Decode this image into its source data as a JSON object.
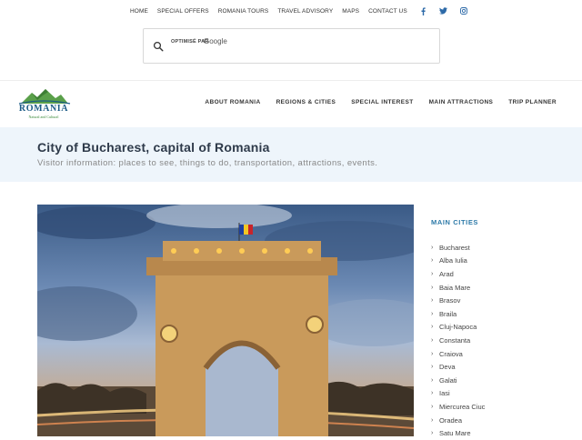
{
  "topnav": {
    "items": [
      "HOME",
      "SPECIAL OFFERS",
      "ROMANIA TOURS",
      "TRAVEL ADVISORY",
      "MAPS",
      "CONTACT US"
    ],
    "social_icons": [
      "facebook-icon",
      "twitter-icon",
      "instagram-icon"
    ]
  },
  "search": {
    "powered_label": "OPTIMISÉ PAR",
    "provider": "Google",
    "value": ""
  },
  "logo": {
    "name": "ROMANIA",
    "tagline": "Natural and Cultural"
  },
  "mainnav": {
    "items": [
      "ABOUT ROMANIA",
      "REGIONS & CITIES",
      "SPECIAL INTEREST",
      "MAIN ATTRACTIONS",
      "TRIP PLANNER"
    ]
  },
  "band": {
    "title": "City of Bucharest, capital of Romania",
    "subtitle": "Visitor information: places to see, things to do, transportation, attractions, events."
  },
  "sidebar": {
    "heading": "MAIN CITIES",
    "cities": [
      "Bucharest",
      "Alba Iulia",
      "Arad",
      "Baia Mare",
      "Brasov",
      "Braila",
      "Cluj-Napoca",
      "Constanta",
      "Craiova",
      "Deva",
      "Galati",
      "Iasi",
      "Miercurea Ciuc",
      "Oradea",
      "Satu Mare"
    ]
  },
  "colors": {
    "accent": "#2d7aa8",
    "band_bg": "#eef5fb",
    "title": "#2e3a4a"
  }
}
